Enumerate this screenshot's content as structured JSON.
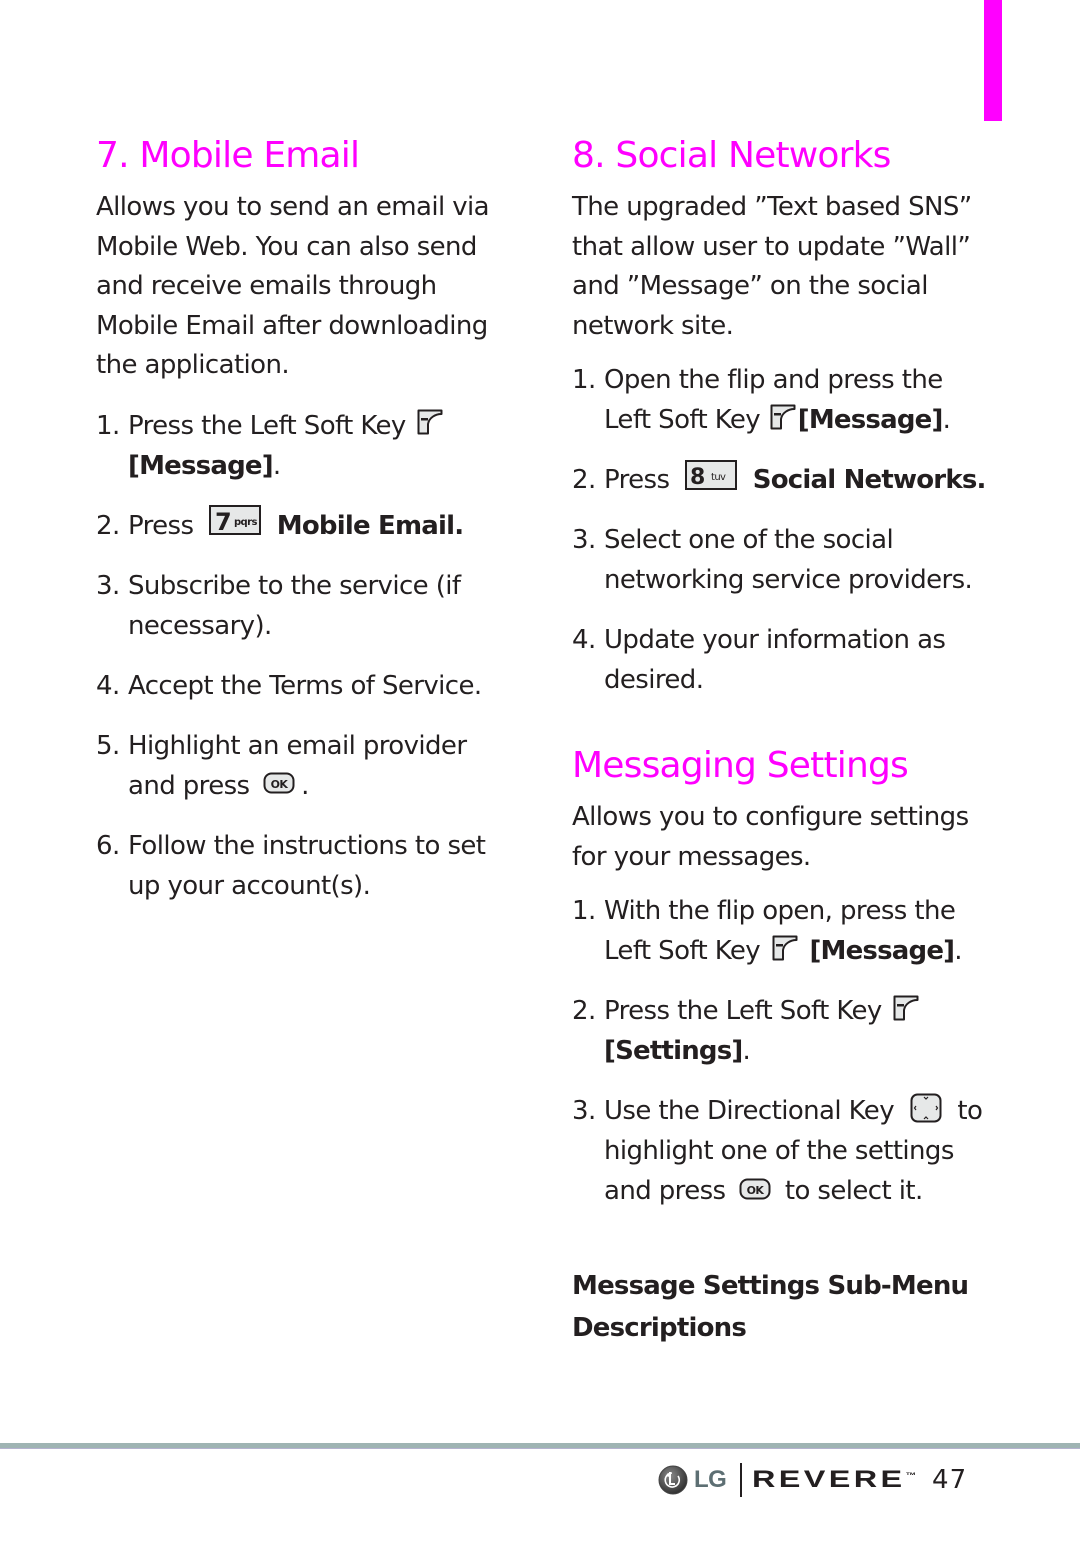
{
  "colors": {
    "accent": "#ff00ff",
    "text": "#231f20",
    "footer_rule": "#9fb4b3",
    "key_fill": "#e6e8e8"
  },
  "left": {
    "title": "7. Mobile Email",
    "intro": "Allows you to send an email via Mobile Web. You can also send and receive emails through Mobile Email after downloading the application.",
    "steps": [
      {
        "num": "1.",
        "pre": "Press the Left Soft Key",
        "icon": "left-soft-key-icon",
        "bold": "[Message]",
        "post": "."
      },
      {
        "num": "2.",
        "pre": "Press",
        "icon": "key-7-pqrs-icon",
        "key_digit": "7",
        "key_letters": "pqrs",
        "bold": "Mobile Email.",
        "post": ""
      },
      {
        "num": "3.",
        "text": "Subscribe to the service (if necessary)."
      },
      {
        "num": "4.",
        "text": "Accept the Terms of Service."
      },
      {
        "num": "5.",
        "pre": "Highlight an email provider and press",
        "icon": "ok-key-icon",
        "key_label": "OK",
        "post": "."
      },
      {
        "num": "6.",
        "text": "Follow the instructions to set up your account(s)."
      }
    ]
  },
  "right": {
    "title": "8. Social Networks",
    "intro": "The upgraded ”Text based SNS” that allow user to update ”Wall” and ”Message” on the social network site.",
    "steps": [
      {
        "num": "1.",
        "pre": "Open the flip and press the Left Soft Key",
        "icon": "left-soft-key-icon",
        "bold": "[Message]",
        "post": "."
      },
      {
        "num": "2.",
        "pre": "Press",
        "icon": "key-8-tuv-icon",
        "key_digit": "8",
        "key_letters": "tuv",
        "bold": "Social Networks.",
        "post": ""
      },
      {
        "num": "3.",
        "text": "Select one of the social networking service providers."
      },
      {
        "num": "4.",
        "text": "Update your information as desired."
      }
    ]
  },
  "settings": {
    "title": "Messaging Settings",
    "intro": "Allows you to configure settings for your messages.",
    "steps": [
      {
        "num": "1.",
        "pre": "With the flip open, press the Left Soft Key",
        "icon": "left-soft-key-icon",
        "bold": "[Message]",
        "post": "."
      },
      {
        "num": "2.",
        "pre": "Press the Left Soft Key",
        "icon": "left-soft-key-icon",
        "bold": "[Settings]",
        "post": "."
      },
      {
        "num": "3.",
        "pre": "Use the Directional Key",
        "icon": "directional-key-icon",
        "mid": "to highlight one of the settings and press",
        "icon2": "ok-key-icon",
        "key_label": "OK",
        "post": "to select it."
      }
    ],
    "subheading": "Message Settings Sub-Menu Descriptions"
  },
  "footer": {
    "brand": "LG",
    "product": "REVERE",
    "trademark": "™",
    "page_number": "47"
  }
}
